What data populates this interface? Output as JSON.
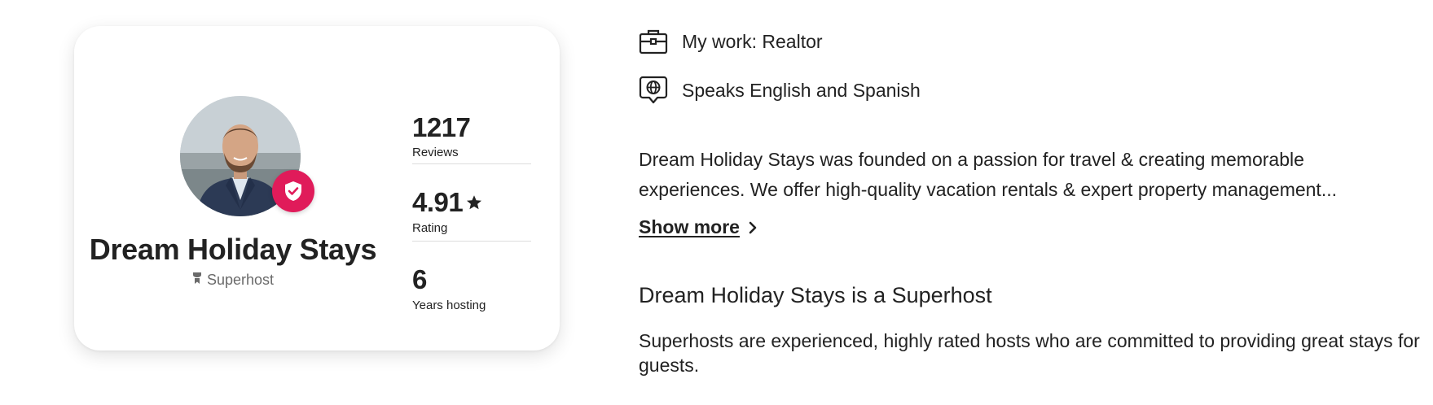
{
  "host_card": {
    "name": "Dream Holiday Stays",
    "superhost_label": "Superhost",
    "stats": [
      {
        "value": "1217",
        "label": "Reviews"
      },
      {
        "value": "4.91",
        "label": "Rating",
        "icon": "star-icon"
      },
      {
        "value": "6",
        "label": "Years hosting"
      }
    ],
    "badge_icon": "verified-shield-icon",
    "superhost_icon": "superhost-ribbon-icon"
  },
  "details": [
    {
      "icon": "briefcase-icon",
      "text": "My work: Realtor"
    },
    {
      "icon": "language-globe-icon",
      "text": "Speaks English and Spanish"
    }
  ],
  "about": {
    "line1": "Dream Holiday Stays was founded on a passion for travel & creating memorable",
    "line2": "experiences. We offer high-quality vacation rentals & expert property management..."
  },
  "show_more": {
    "label": "Show more",
    "icon": "chevron-right-icon"
  },
  "superhost_section": {
    "heading": "Dream Holiday Stays is a Superhost",
    "description": "Superhosts are experienced, highly rated hosts who are committed to providing great stays for guests."
  },
  "colors": {
    "text": "#222222",
    "muted": "#6a6a6a",
    "brand_accent": "#e01b5a",
    "divider": "#dddddd"
  }
}
